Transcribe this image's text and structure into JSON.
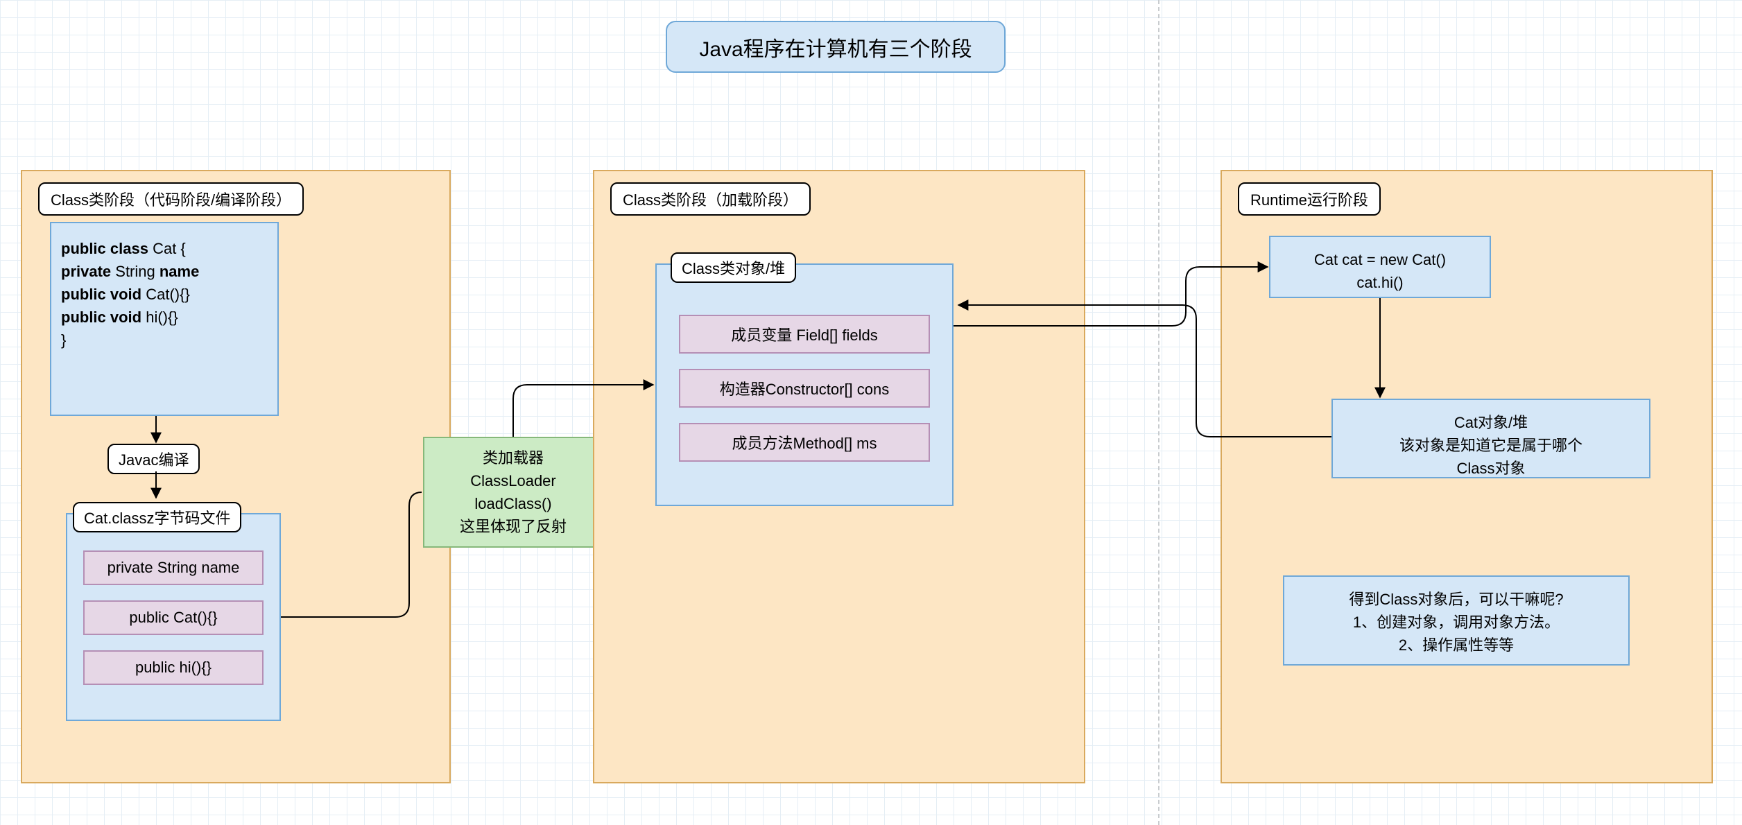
{
  "title": "Java程序在计算机有三个阶段",
  "stage1": {
    "label": "Class类阶段（代码阶段/编译阶段）",
    "code": "public class Cat {\nprivate String name\npublic void Cat(){}\npublic void hi(){}\n}",
    "javac": "Javac编译",
    "bytecode_label": "Cat.classz字节码文件",
    "items": [
      "private String name",
      "public Cat(){}",
      "public hi(){}"
    ]
  },
  "loader": {
    "l1": "类加载器",
    "l2": "ClassLoader",
    "l3": "loadClass()",
    "l4": "这里体现了反射"
  },
  "stage2": {
    "label": "Class类阶段（加载阶段）",
    "class_label": "Class类对象/堆",
    "items": [
      "成员变量 Field[] fields",
      "构造器Constructor[]  cons",
      "成员方法Method[]  ms"
    ]
  },
  "stage3": {
    "label": "Runtime运行阶段",
    "runtime1": "Cat cat = new Cat()",
    "runtime2": "cat.hi()",
    "heap_l1": "Cat对象/堆",
    "heap_l2": "该对象是知道它是属于哪个",
    "heap_l3": "Class对象",
    "note_l1": "得到Class对象后，可以干嘛呢?",
    "note_l2": "1、创建对象，调用对象方法。",
    "note_l3": "2、操作属性等等"
  }
}
